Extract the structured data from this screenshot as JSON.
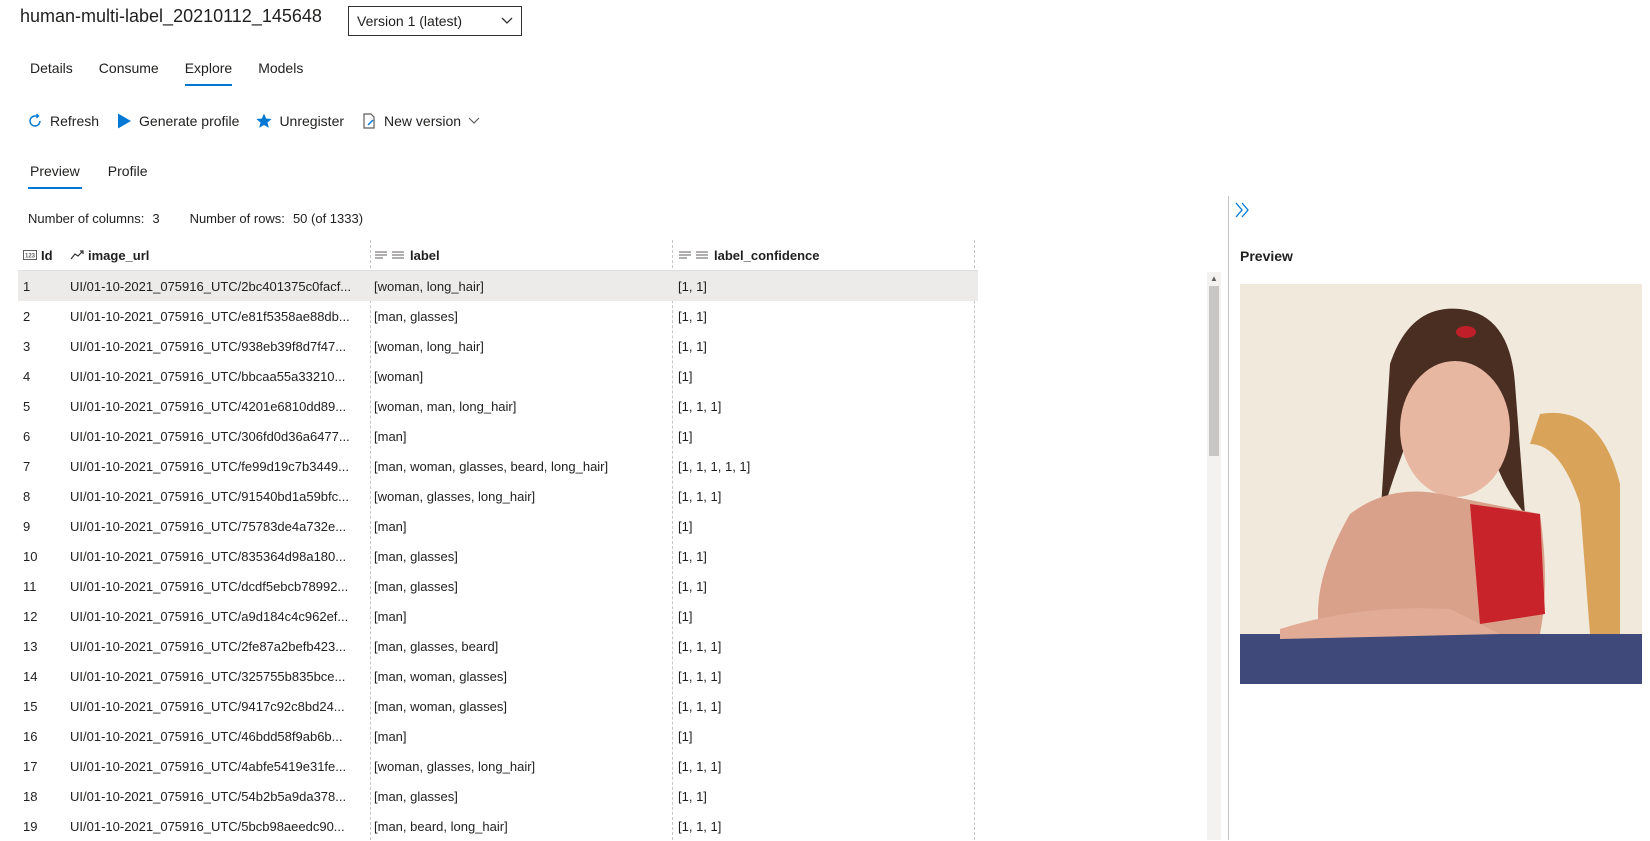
{
  "header": {
    "title": "human-multi-label_20210112_145648",
    "version_select": "Version 1 (latest)"
  },
  "nav_tabs": [
    {
      "label": "Details"
    },
    {
      "label": "Consume"
    },
    {
      "label": "Explore",
      "active": true
    },
    {
      "label": "Models"
    }
  ],
  "toolbar": {
    "refresh": "Refresh",
    "generate_profile": "Generate profile",
    "unregister": "Unregister",
    "new_version": "New version"
  },
  "subtabs": [
    {
      "label": "Preview",
      "active": true
    },
    {
      "label": "Profile"
    }
  ],
  "stats": {
    "columns_label": "Number of columns:",
    "columns_value": "3",
    "rows_label": "Number of rows:",
    "rows_value": "50 (of 1333)"
  },
  "table": {
    "columns": [
      "Id",
      "image_url",
      "label",
      "label_confidence"
    ],
    "rows": [
      [
        "1",
        "UI/01-10-2021_075916_UTC/2bc401375c0facf...",
        "[woman, long_hair]",
        "[1, 1]"
      ],
      [
        "2",
        "UI/01-10-2021_075916_UTC/e81f5358ae88db...",
        "[man, glasses]",
        "[1, 1]"
      ],
      [
        "3",
        "UI/01-10-2021_075916_UTC/938eb39f8d7f47...",
        "[woman, long_hair]",
        "[1, 1]"
      ],
      [
        "4",
        "UI/01-10-2021_075916_UTC/bbcaa55a33210...",
        "[woman]",
        "[1]"
      ],
      [
        "5",
        "UI/01-10-2021_075916_UTC/4201e6810dd89...",
        "[woman, man, long_hair]",
        "[1, 1, 1]"
      ],
      [
        "6",
        "UI/01-10-2021_075916_UTC/306fd0d36a6477...",
        "[man]",
        "[1]"
      ],
      [
        "7",
        "UI/01-10-2021_075916_UTC/fe99d19c7b3449...",
        "[man, woman, glasses, beard, long_hair]",
        "[1, 1, 1, 1, 1]"
      ],
      [
        "8",
        "UI/01-10-2021_075916_UTC/91540bd1a59bfc...",
        "[woman, glasses, long_hair]",
        "[1, 1, 1]"
      ],
      [
        "9",
        "UI/01-10-2021_075916_UTC/75783de4a732e...",
        "[man]",
        "[1]"
      ],
      [
        "10",
        "UI/01-10-2021_075916_UTC/835364d98a180...",
        "[man, glasses]",
        "[1, 1]"
      ],
      [
        "11",
        "UI/01-10-2021_075916_UTC/dcdf5ebcb78992...",
        "[man, glasses]",
        "[1, 1]"
      ],
      [
        "12",
        "UI/01-10-2021_075916_UTC/a9d184c4c962ef...",
        "[man]",
        "[1]"
      ],
      [
        "13",
        "UI/01-10-2021_075916_UTC/2fe87a2befb423...",
        "[man, glasses, beard]",
        "[1, 1, 1]"
      ],
      [
        "14",
        "UI/01-10-2021_075916_UTC/325755b835bce...",
        "[man, woman, glasses]",
        "[1, 1, 1]"
      ],
      [
        "15",
        "UI/01-10-2021_075916_UTC/9417c92c8bd24...",
        "[man, woman, glasses]",
        "[1, 1, 1]"
      ],
      [
        "16",
        "UI/01-10-2021_075916_UTC/46bdd58f9ab6b...",
        "[man]",
        "[1]"
      ],
      [
        "17",
        "UI/01-10-2021_075916_UTC/4abfe5419e31fe...",
        "[woman, glasses, long_hair]",
        "[1, 1, 1]"
      ],
      [
        "18",
        "UI/01-10-2021_075916_UTC/54b2b5a9da378...",
        "[man, glasses]",
        "[1, 1]"
      ],
      [
        "19",
        "UI/01-10-2021_075916_UTC/5bcb98aeedc90...",
        "[man, beard, long_hair]",
        "[1, 1, 1]"
      ]
    ]
  },
  "preview_panel": {
    "title": "Preview"
  },
  "colors": {
    "accent": "#0078d4",
    "selected_row": "#edebe9"
  }
}
